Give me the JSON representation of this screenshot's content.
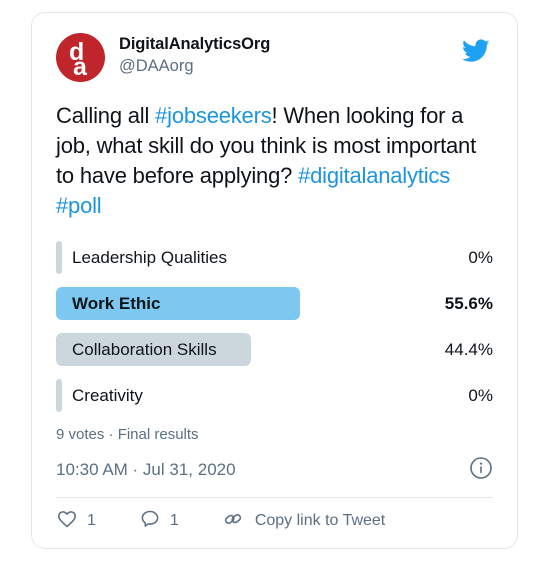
{
  "tweet": {
    "author": {
      "display_name": "DigitalAnalyticsOrg",
      "handle": "@DAAorg",
      "avatar_letter_1": "d",
      "avatar_letter_2": "a",
      "avatar_color": "#c0252b"
    },
    "platform_icon": "twitter-bird-icon",
    "text_parts": [
      {
        "text": "Calling all ",
        "type": "plain"
      },
      {
        "text": "#jobseekers",
        "type": "hashtag"
      },
      {
        "text": "! When looking for a job, what skill do you think is most important to have before applying? ",
        "type": "plain"
      },
      {
        "text": "#digitalanalytics",
        "type": "hashtag"
      },
      {
        "text": " ",
        "type": "plain"
      },
      {
        "text": "#poll",
        "type": "hashtag"
      }
    ],
    "link_color": "#1b95e0"
  },
  "poll": {
    "options": [
      {
        "label": "Leadership Qualities",
        "percent": "0%",
        "value": 0,
        "winner": false
      },
      {
        "label": "Work Ethic",
        "percent": "55.6%",
        "value": 55.6,
        "winner": true
      },
      {
        "label": "Collaboration Skills",
        "percent": "44.4%",
        "value": 44.4,
        "winner": false
      },
      {
        "label": "Creativity",
        "percent": "0%",
        "value": 0,
        "winner": false
      }
    ],
    "winner_bar_color": "#7cc8f0",
    "bar_color": "#ccd6dd",
    "meta": "9 votes · Final results",
    "votes": 9,
    "status": "Final results"
  },
  "timestamp": {
    "text": "10:30 AM · Jul 31, 2020",
    "info_icon": "info-circle-icon"
  },
  "actions": [
    {
      "icon": "heart-icon",
      "label": "1",
      "name": "like"
    },
    {
      "icon": "reply-icon",
      "label": "1",
      "name": "reply"
    },
    {
      "icon": "link-icon",
      "label": "Copy link to Tweet",
      "name": "copy-link"
    }
  ]
}
